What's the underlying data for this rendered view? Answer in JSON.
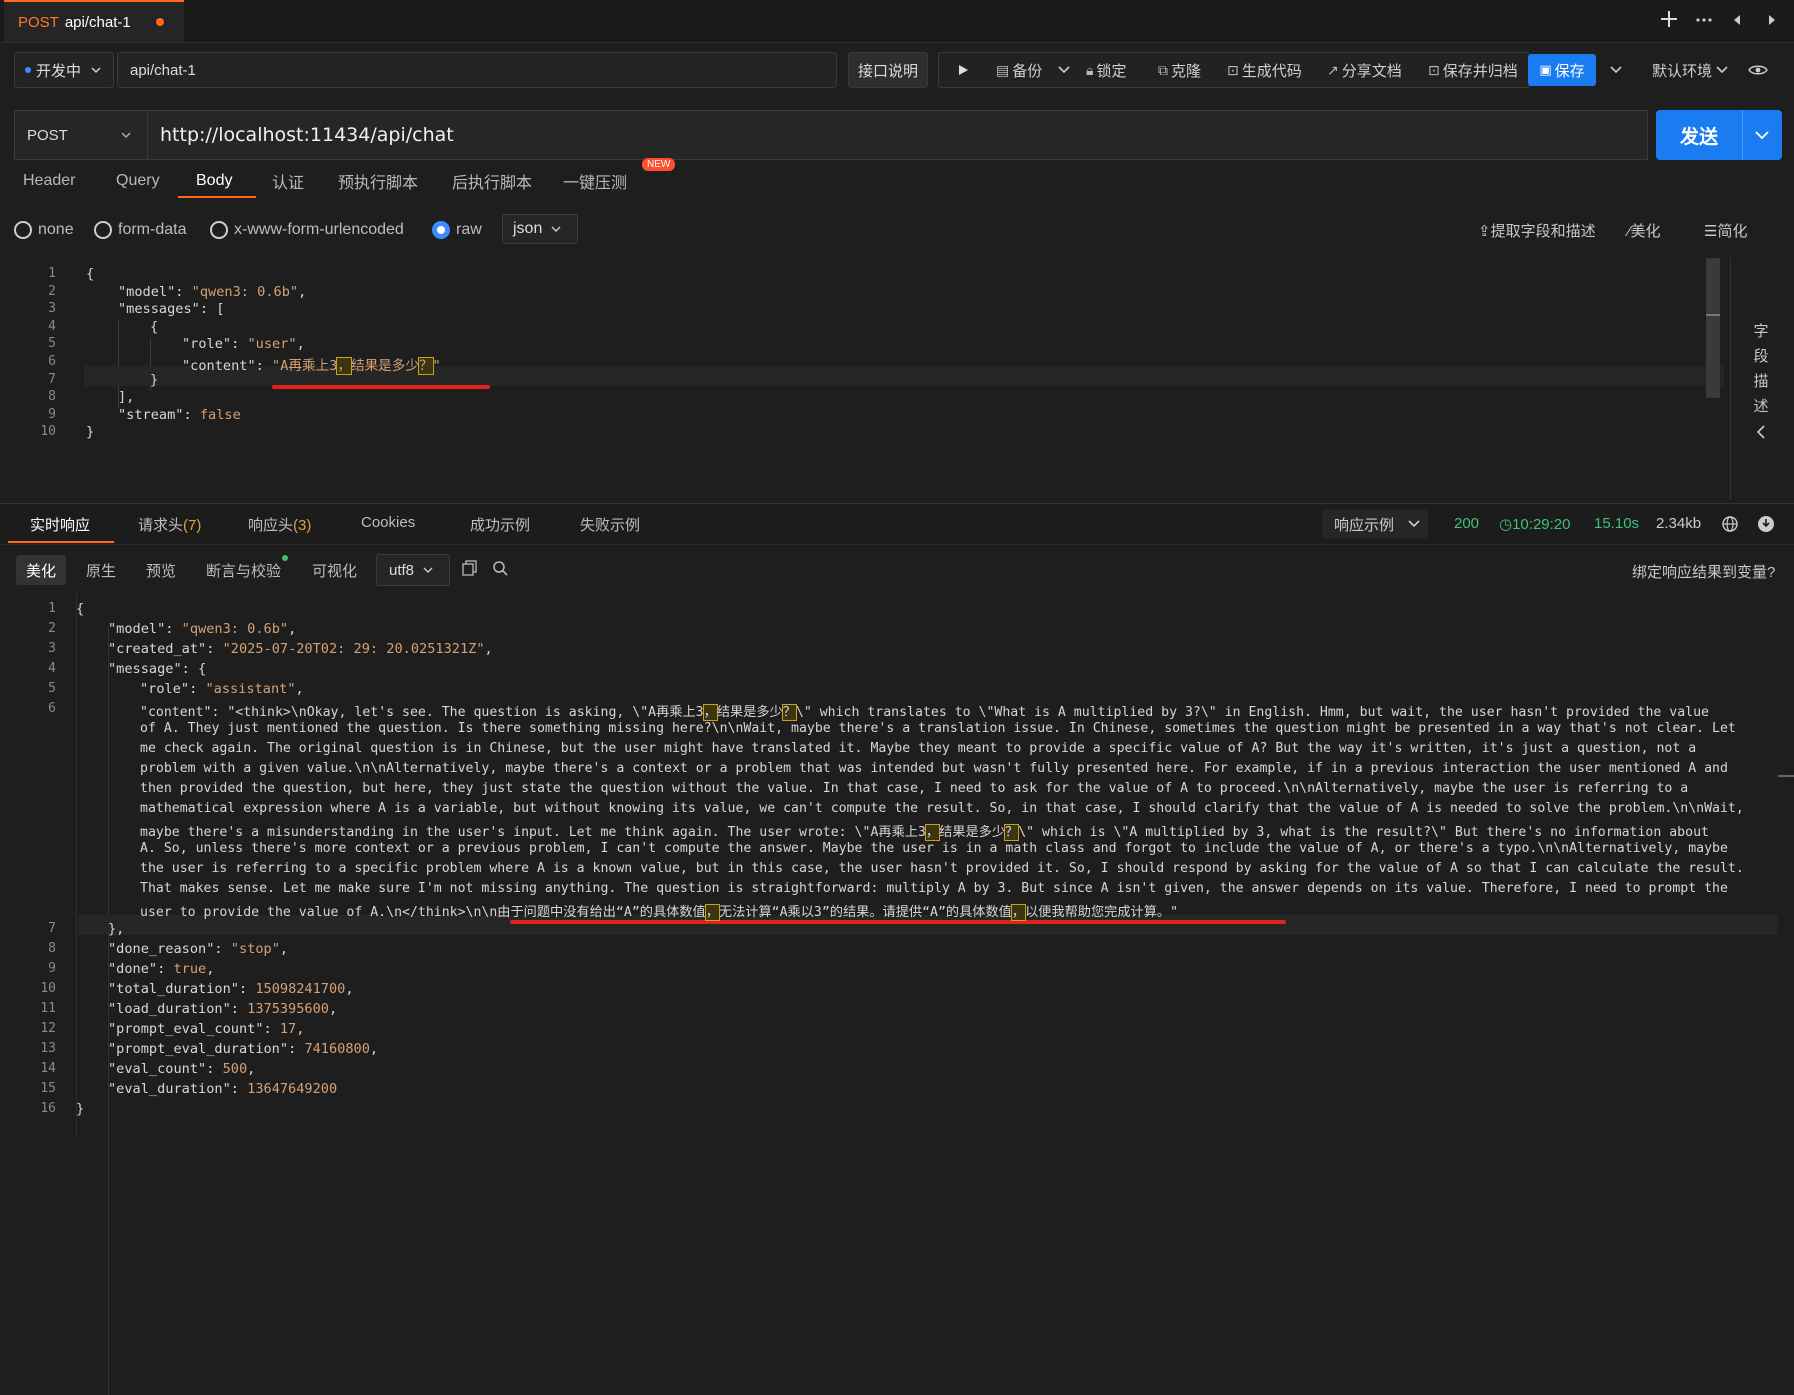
{
  "tab": {
    "method": "POST",
    "name": "api/chat-1"
  },
  "toolbar": {
    "status": "开发中",
    "name": "api/chat-1",
    "api_doc": "接口说明",
    "backup": "备份",
    "lock": "锁定",
    "clone": "克隆",
    "gen_code": "生成代码",
    "share_doc": "分享文档",
    "save_archive": "保存并归档",
    "save": "保存",
    "env": "默认环境"
  },
  "request": {
    "method": "POST",
    "url": "http://localhost:11434/api/chat",
    "send": "发送",
    "tabs": [
      "Header",
      "Query",
      "Body",
      "认证",
      "预执行脚本",
      "后执行脚本",
      "一键压测"
    ],
    "new_badge": "NEW",
    "body_types": [
      "none",
      "form-data",
      "x-www-form-urlencoded",
      "raw"
    ],
    "format": "json",
    "tools": {
      "extract": "提取字段和描述",
      "beautify": "美化",
      "simplify": "简化"
    },
    "side_label": [
      "字",
      "段",
      "描",
      "述"
    ]
  },
  "request_body_lines": [
    "{",
    "    \"model\": \"qwen3:0.6b\",",
    "    \"messages\": [",
    "        {",
    "            \"role\": \"user\",",
    "            \"content\": \"A再乘上3，结果是多少？\"",
    "        }",
    "    ],",
    "    \"stream\": false",
    "}"
  ],
  "response": {
    "tabs": {
      "live": "实时响应",
      "req_headers": "请求头",
      "req_headers_count": "(7)",
      "resp_headers": "响应头",
      "resp_headers_count": "(3)",
      "cookies": "Cookies",
      "success": "成功示例",
      "fail": "失败示例"
    },
    "example": "响应示例",
    "status": "200",
    "time": "10:29:20",
    "duration": "15.10s",
    "size": "2.34kb",
    "sub_tabs": [
      "美化",
      "原生",
      "预览",
      "断言与校验",
      "可视化"
    ],
    "encoding": "utf8",
    "bind": "绑定响应结果到变量?"
  },
  "response_lines": {
    "l2": "\"model\": \"qwen3:0.6b\",",
    "l3": "\"created_at\": \"2025-07-20T02:29:20.0251321Z\",",
    "l4": "\"message\": {",
    "l5": "\"role\": \"assistant\",",
    "content_rows": [
      "\"content\": \"<think>\\nOkay, let's see. The question is asking, \\\"A再乘上3，结果是多少？\\\" which translates to \\\"What is A multiplied by 3?\\\" in English. Hmm, but wait, the user hasn't provided the value",
      "of A. They just mentioned the question. Is there something missing here?\\n\\nWait, maybe there's a translation issue. In Chinese, sometimes the question might be presented in a way that's not clear. Let",
      "me check again. The original question is in Chinese, but the user might have translated it. Maybe they meant to provide a specific value of A? But the way it's written, it's just a question, not a",
      "problem with a given value.\\n\\nAlternatively, maybe there's a context or a problem that was intended but wasn't fully presented here. For example, if in a previous interaction the user mentioned A and",
      "then provided the question, but here, they just state the question without the value. In that case, I need to ask for the value of A to proceed.\\n\\nAlternatively, maybe the user is referring to a",
      "mathematical expression where A is a variable, but without knowing its value, we can't compute the result. So, in that case, I should clarify that the value of A is needed to solve the problem.\\n\\nWait,",
      "maybe there's a misunderstanding in the user's input. Let me think again. The user wrote: \\\"A再乘上3，结果是多少？\\\" which is \\\"A multiplied by 3, what is the result?\\\" But there's no information about",
      "A. So, unless there's more context or a previous problem, I can't compute the answer. Maybe the user is in a math class and forgot to include the value of A, or there's a typo.\\n\\nAlternatively, maybe",
      "the user is referring to a specific problem where A is a known value, but in this case, the user hasn't provided it. So, I should respond by asking for the value of A so that I can calculate the result.",
      "That makes sense. Let me make sure I'm not missing anything. The question is straightforward: multiply A by 3. But since A isn't given, the answer depends on its value. Therefore, I need to prompt the",
      "user to provide the value of A.\\n</think>\\n\\n由于问题中没有给出“A”的具体数值，无法计算“A乘以3”的结果。请提供“A”的具体数值，以便我帮助您完成计算。\""
    ],
    "l7": "},",
    "l8": "\"done_reason\": \"stop\",",
    "l9": "\"done\": true,",
    "l10": "\"total_duration\": 15098241700,",
    "l11": "\"load_duration\": 1375395600,",
    "l12": "\"prompt_eval_count\": 17,",
    "l13": "\"prompt_eval_duration\": 74160800,",
    "l14": "\"eval_count\": 500,",
    "l15": "\"eval_duration\": 13647649200"
  },
  "colors": {
    "accent": "#ff6a1a",
    "primary": "#1a7cf0",
    "success": "#3fc17a",
    "string": "#d6a074",
    "highlight_underline": "#e2231a"
  }
}
